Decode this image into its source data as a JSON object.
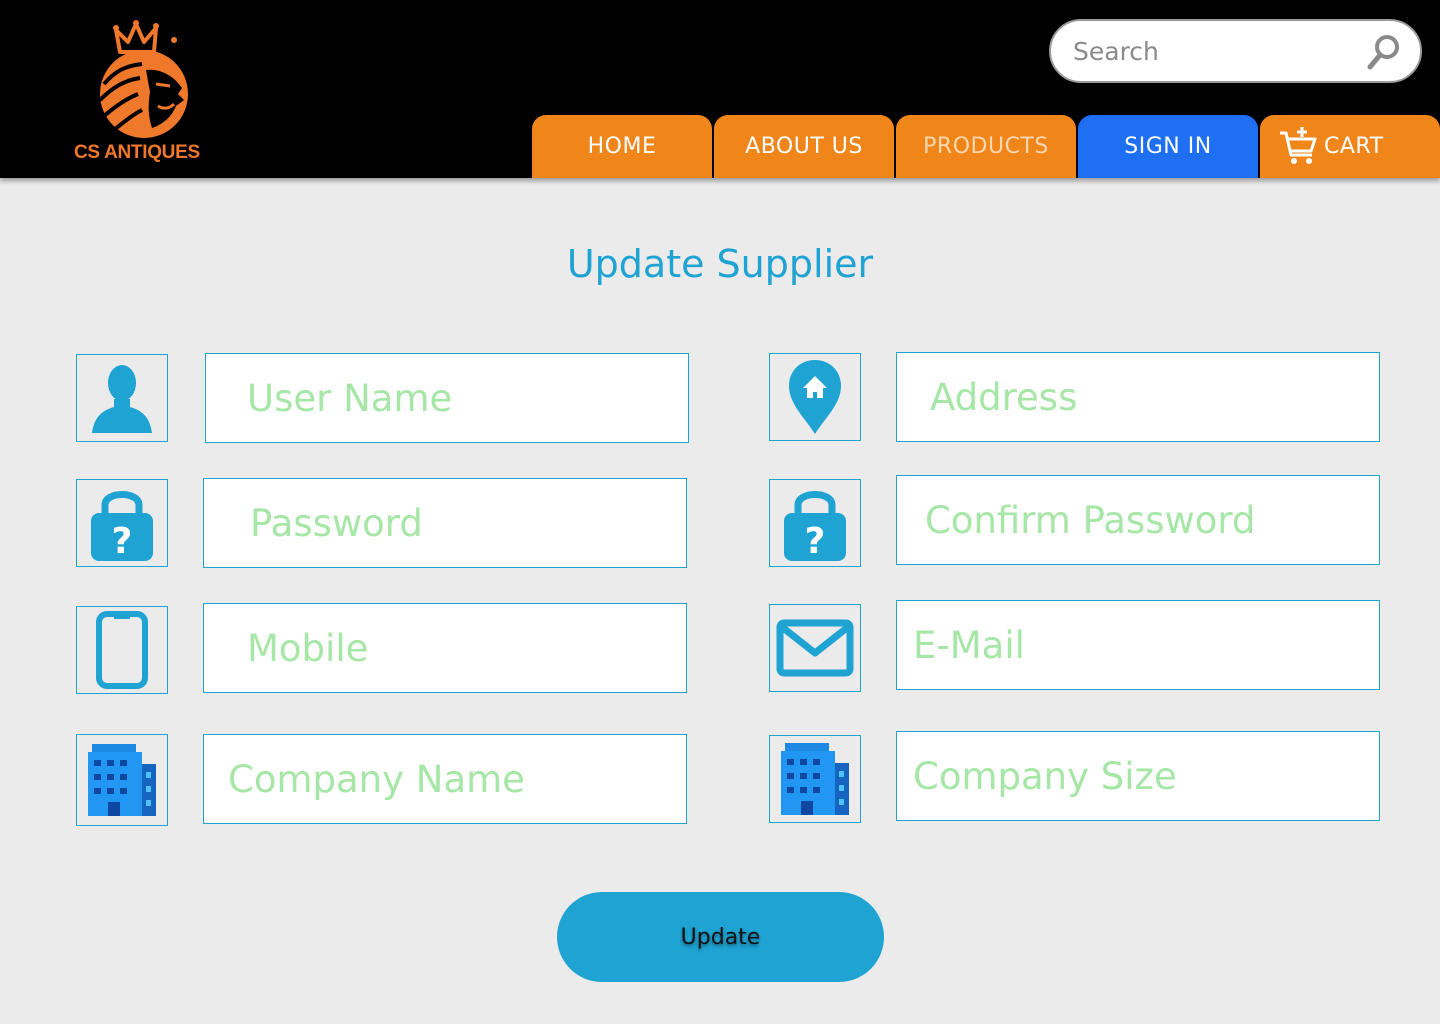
{
  "brand": {
    "name": "CS ANTIQUES",
    "accent": "#f0782a"
  },
  "search": {
    "placeholder": "Search"
  },
  "nav": {
    "home": "HOME",
    "about": "ABOUT US",
    "products": "PRODUCTS",
    "signin": "SIGN IN",
    "cart": "CART"
  },
  "colors": {
    "nav_orange": "#f08519",
    "nav_blue": "#1f6ff2",
    "form_blue": "#1ea3d3",
    "placeholder_green": "#a6e6a6"
  },
  "form": {
    "title": "Update Supplier",
    "fields": {
      "user_name": {
        "placeholder": "User Name",
        "icon": "user-icon"
      },
      "password": {
        "placeholder": "Password",
        "icon": "lock-question-icon"
      },
      "mobile": {
        "placeholder": "Mobile",
        "icon": "mobile-phone-icon"
      },
      "company_name": {
        "placeholder": "Company Name",
        "icon": "building-icon"
      },
      "address": {
        "placeholder": "Address",
        "icon": "location-home-icon"
      },
      "confirm_password": {
        "placeholder": "Confirm Password",
        "icon": "lock-question-icon"
      },
      "email": {
        "placeholder": "E-Mail",
        "icon": "mail-icon"
      },
      "company_size": {
        "placeholder": "Company Size",
        "icon": "building-icon"
      }
    },
    "submit_label": "Update"
  }
}
